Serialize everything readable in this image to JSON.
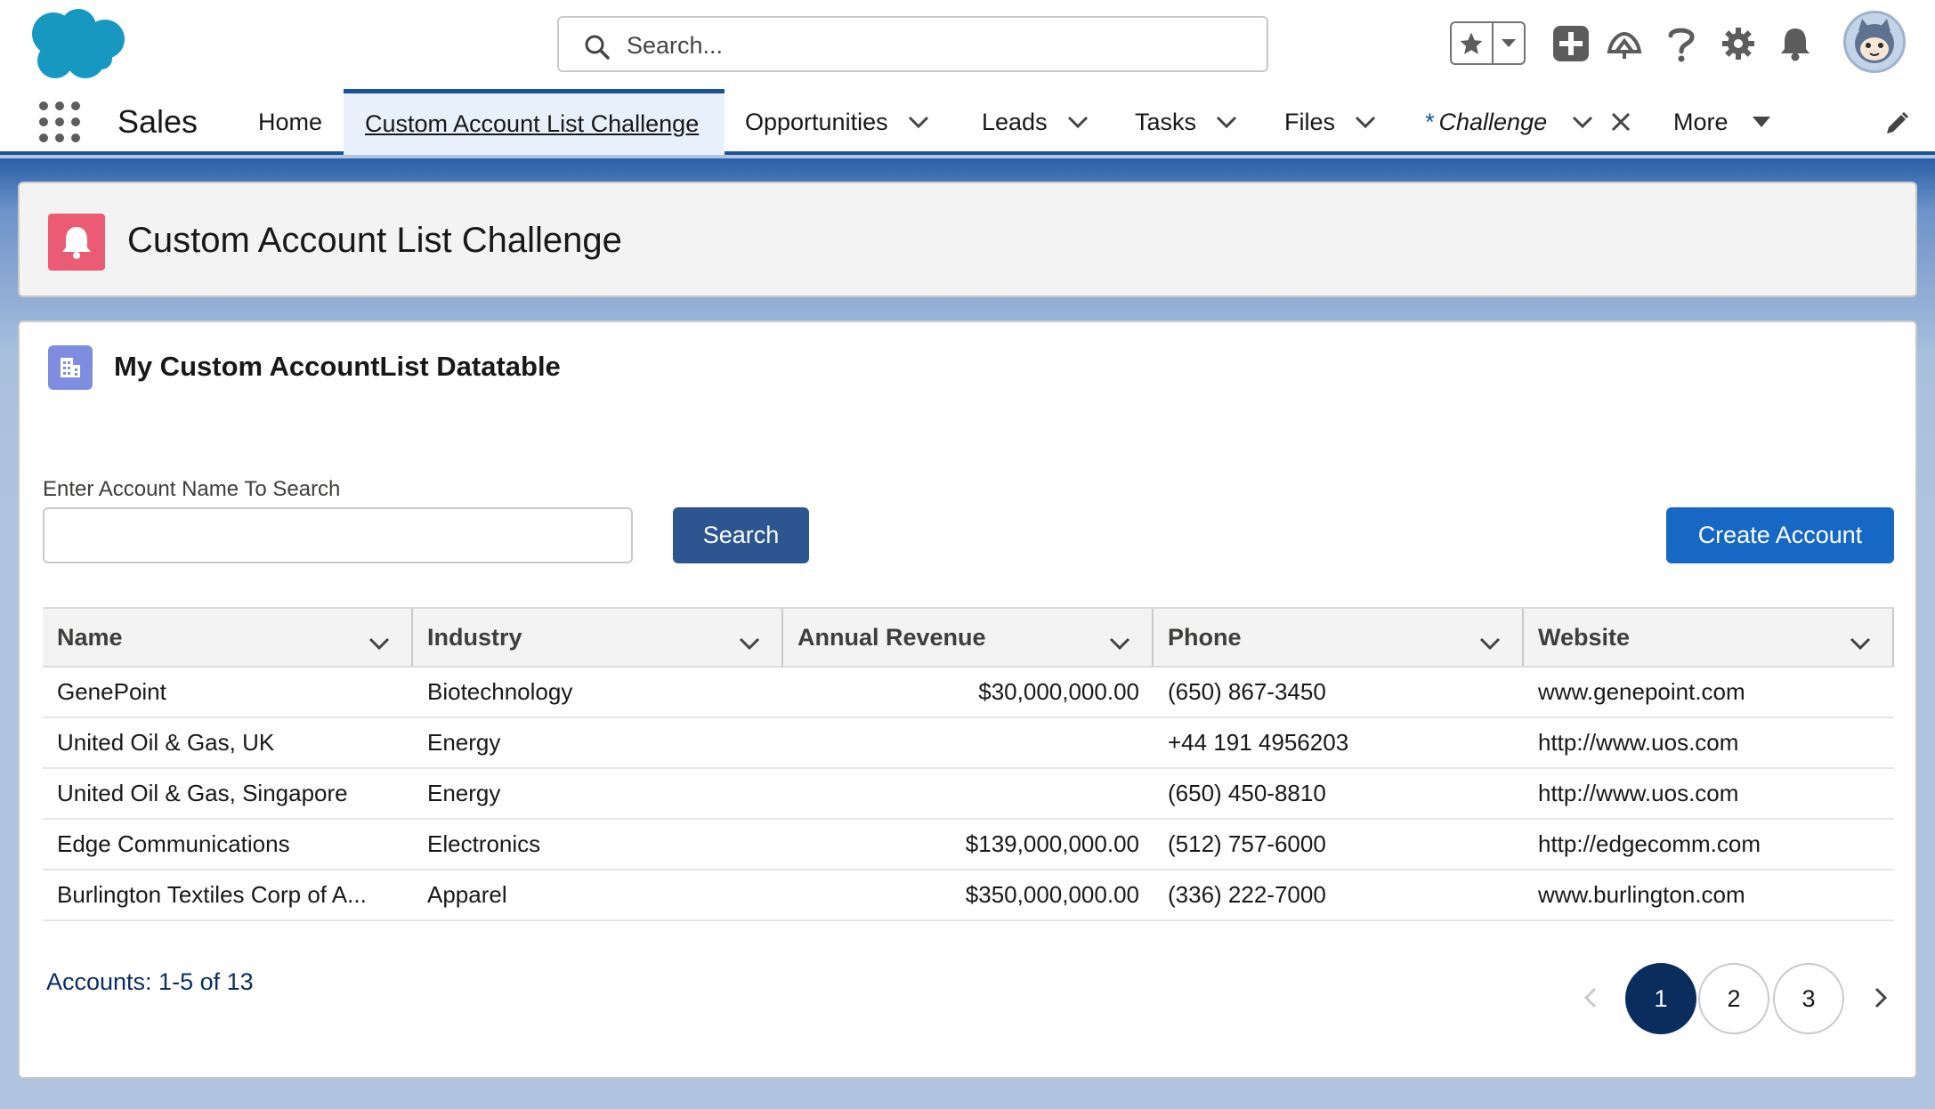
{
  "header": {
    "search_placeholder": "Search...",
    "icons": [
      "salesforce-cloud-logo",
      "star-icon",
      "chevron-down-icon",
      "add-icon",
      "trailhead-icon",
      "help-icon",
      "setup-gear-icon",
      "notification-bell-icon",
      "user-avatar"
    ]
  },
  "nav": {
    "app_name": "Sales",
    "items": [
      {
        "label": "Home",
        "has_menu": false
      },
      {
        "label": "Custom Account List Challenge",
        "active": true
      },
      {
        "label": "Opportunities",
        "has_menu": true
      },
      {
        "label": "Leads",
        "has_menu": true
      },
      {
        "label": "Tasks",
        "has_menu": true
      },
      {
        "label": "Files",
        "has_menu": true
      },
      {
        "label": "Challenge",
        "prefix": "*",
        "italic": true,
        "has_menu": true,
        "closable": true
      },
      {
        "label": "More",
        "has_menu": true
      }
    ]
  },
  "page_header": {
    "title": "Custom Account List Challenge",
    "icon": "bell-icon",
    "icon_color": "#ec5b74"
  },
  "card": {
    "title": "My Custom AccountList Datatable",
    "icon": "account-building-icon",
    "icon_color": "#7f8de1",
    "search": {
      "label": "Enter Account Name To Search",
      "value": "",
      "button_label": "Search"
    },
    "create_button_label": "Create Account"
  },
  "table": {
    "columns": [
      "Name",
      "Industry",
      "Annual Revenue",
      "Phone",
      "Website"
    ],
    "rows": [
      [
        "GenePoint",
        "Biotechnology",
        "$30,000,000.00",
        "(650) 867-3450",
        "www.genepoint.com"
      ],
      [
        "United Oil & Gas, UK",
        "Energy",
        "",
        "+44 191 4956203",
        "http://www.uos.com"
      ],
      [
        "United Oil & Gas, Singapore",
        "Energy",
        "",
        "(650) 450-8810",
        "http://www.uos.com"
      ],
      [
        "Edge Communications",
        "Electronics",
        "$139,000,000.00",
        "(512) 757-6000",
        "http://edgecomm.com"
      ],
      [
        "Burlington Textiles Corp of A...",
        "Apparel",
        "$350,000,000.00",
        "(336) 222-7000",
        "www.burlington.com"
      ]
    ]
  },
  "footer": {
    "count_text": "Accounts: 1-5 of 13",
    "pages": [
      "1",
      "2",
      "3"
    ],
    "current_page": "1"
  },
  "colors": {
    "brand_blue": "#1b5297",
    "nav_active_bg": "#e8f0fb",
    "search_button": "#2d558f",
    "create_button": "#1768c4",
    "pager_active": "#0b2d5e",
    "salesforce_cloud": "#1798c1"
  }
}
